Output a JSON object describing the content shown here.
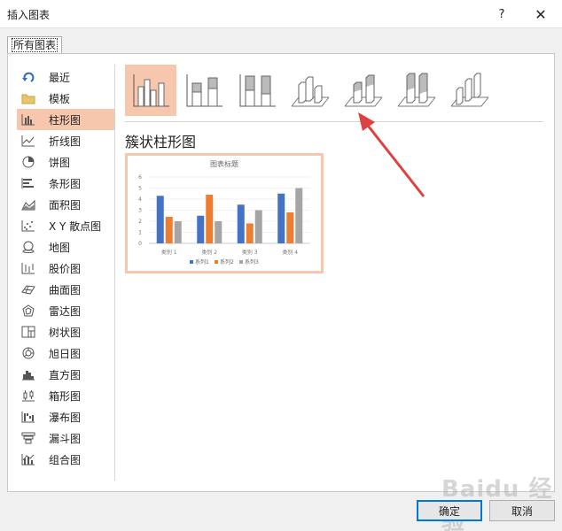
{
  "window": {
    "title": "插入图表",
    "help_label": "?",
    "close_label": "✕"
  },
  "tab": {
    "label": "所有图表"
  },
  "sidebar": {
    "items": [
      {
        "label": "最近",
        "icon": "recent-icon"
      },
      {
        "label": "模板",
        "icon": "folder-icon"
      },
      {
        "label": "柱形图",
        "icon": "column-chart-icon",
        "selected": true
      },
      {
        "label": "折线图",
        "icon": "line-chart-icon"
      },
      {
        "label": "饼图",
        "icon": "pie-chart-icon"
      },
      {
        "label": "条形图",
        "icon": "bar-chart-icon"
      },
      {
        "label": "面积图",
        "icon": "area-chart-icon"
      },
      {
        "label": "X Y 散点图",
        "icon": "scatter-chart-icon"
      },
      {
        "label": "地图",
        "icon": "map-chart-icon"
      },
      {
        "label": "股价图",
        "icon": "stock-chart-icon"
      },
      {
        "label": "曲面图",
        "icon": "surface-chart-icon"
      },
      {
        "label": "雷达图",
        "icon": "radar-chart-icon"
      },
      {
        "label": "树状图",
        "icon": "treemap-chart-icon"
      },
      {
        "label": "旭日图",
        "icon": "sunburst-chart-icon"
      },
      {
        "label": "直方图",
        "icon": "histogram-chart-icon"
      },
      {
        "label": "箱形图",
        "icon": "box-whisker-chart-icon"
      },
      {
        "label": "瀑布图",
        "icon": "waterfall-chart-icon"
      },
      {
        "label": "漏斗图",
        "icon": "funnel-chart-icon"
      },
      {
        "label": "组合图",
        "icon": "combo-chart-icon"
      }
    ]
  },
  "subtypes": [
    {
      "icon": "clustered-column-icon",
      "selected": true
    },
    {
      "icon": "stacked-column-icon"
    },
    {
      "icon": "100-stacked-column-icon"
    },
    {
      "icon": "3d-clustered-column-icon"
    },
    {
      "icon": "3d-stacked-column-icon"
    },
    {
      "icon": "3d-100-stacked-column-icon"
    },
    {
      "icon": "3d-column-icon"
    }
  ],
  "main": {
    "heading": "簇状柱形图"
  },
  "chart_data": {
    "type": "bar",
    "title": "图表标题",
    "categories": [
      "类别 1",
      "类别 2",
      "类别 3",
      "类别 4"
    ],
    "series": [
      {
        "name": "系列1",
        "values": [
          4.3,
          2.5,
          3.5,
          4.5
        ],
        "color": "#4472c4"
      },
      {
        "name": "系列2",
        "values": [
          2.4,
          4.4,
          1.8,
          2.8
        ],
        "color": "#ed7d31"
      },
      {
        "name": "系列3",
        "values": [
          2,
          2,
          3,
          5
        ],
        "color": "#a5a5a5"
      }
    ],
    "yticks": [
      "0",
      "1",
      "2",
      "3",
      "4",
      "5",
      "6"
    ],
    "ylim": [
      0,
      6
    ],
    "grid": true,
    "legend": "bottom"
  },
  "buttons": {
    "ok": "确定",
    "cancel": "取消"
  },
  "accent": {
    "selection": "#f6c6ad",
    "arrow": "#e04040",
    "focus": "#0078d7"
  },
  "watermark": "Baidu 经验"
}
